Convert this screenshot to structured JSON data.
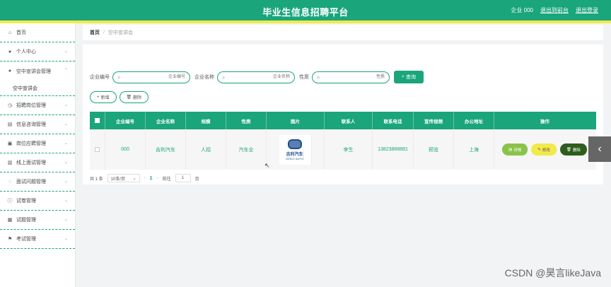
{
  "header": {
    "title": "毕业生信息招聘平台",
    "user": "企业 000",
    "links": [
      "退出到前台",
      "退出登录"
    ]
  },
  "sidebar": {
    "items": [
      {
        "label": "首页",
        "icon": "home-icon"
      },
      {
        "label": "个人中心",
        "icon": "user-icon"
      },
      {
        "label": "空中宣讲会管理",
        "icon": "user-icon",
        "expanded": true,
        "sub": "空中宣讲会"
      },
      {
        "label": "招聘岗位管理",
        "icon": "clock-icon"
      },
      {
        "label": "信息咨询管理",
        "icon": "document-icon"
      },
      {
        "label": "岗位应聘管理",
        "icon": "briefcase-icon"
      },
      {
        "label": "线上面试管理",
        "icon": "chart-icon"
      },
      {
        "label": "面试问题管理",
        "icon": "chat-icon"
      },
      {
        "label": "试卷管理",
        "icon": "info-icon"
      },
      {
        "label": "试题管理",
        "icon": "calendar-icon"
      },
      {
        "label": "考试管理",
        "icon": "flag-icon"
      }
    ]
  },
  "breadcrumb": {
    "home": "首页",
    "current": "空中宣讲会"
  },
  "search": {
    "fields": [
      {
        "label": "企业编号",
        "placeholder": "企业编号"
      },
      {
        "label": "企业名称",
        "placeholder": "企业名称"
      },
      {
        "label": "性质",
        "placeholder": "性质"
      }
    ],
    "button": "查询"
  },
  "actions": {
    "add": "新增",
    "delete": "删除"
  },
  "table": {
    "columns": [
      "企业编号",
      "企业名称",
      "规模",
      "性质",
      "图片",
      "联系人",
      "联系电话",
      "宣传视频",
      "办公地址",
      "操作"
    ],
    "rows": [
      {
        "id": "000",
        "name": "吉利汽车",
        "scale": "人招",
        "nature": "汽车业",
        "logo_text": "吉利汽车",
        "logo_sub": "GEELY AUTO",
        "contact": "李生",
        "phone": "13823888881",
        "video": "预览",
        "address": "上海"
      }
    ],
    "row_actions": {
      "view": "详情",
      "edit": "修改",
      "delete": "删除"
    }
  },
  "pager": {
    "total": "共 1 条",
    "page_size": "10条/页",
    "current": "1",
    "goto_prefix": "前往",
    "goto_value": "1",
    "goto_suffix": "页"
  },
  "watermark": "CSDN @昊言likeJava"
}
